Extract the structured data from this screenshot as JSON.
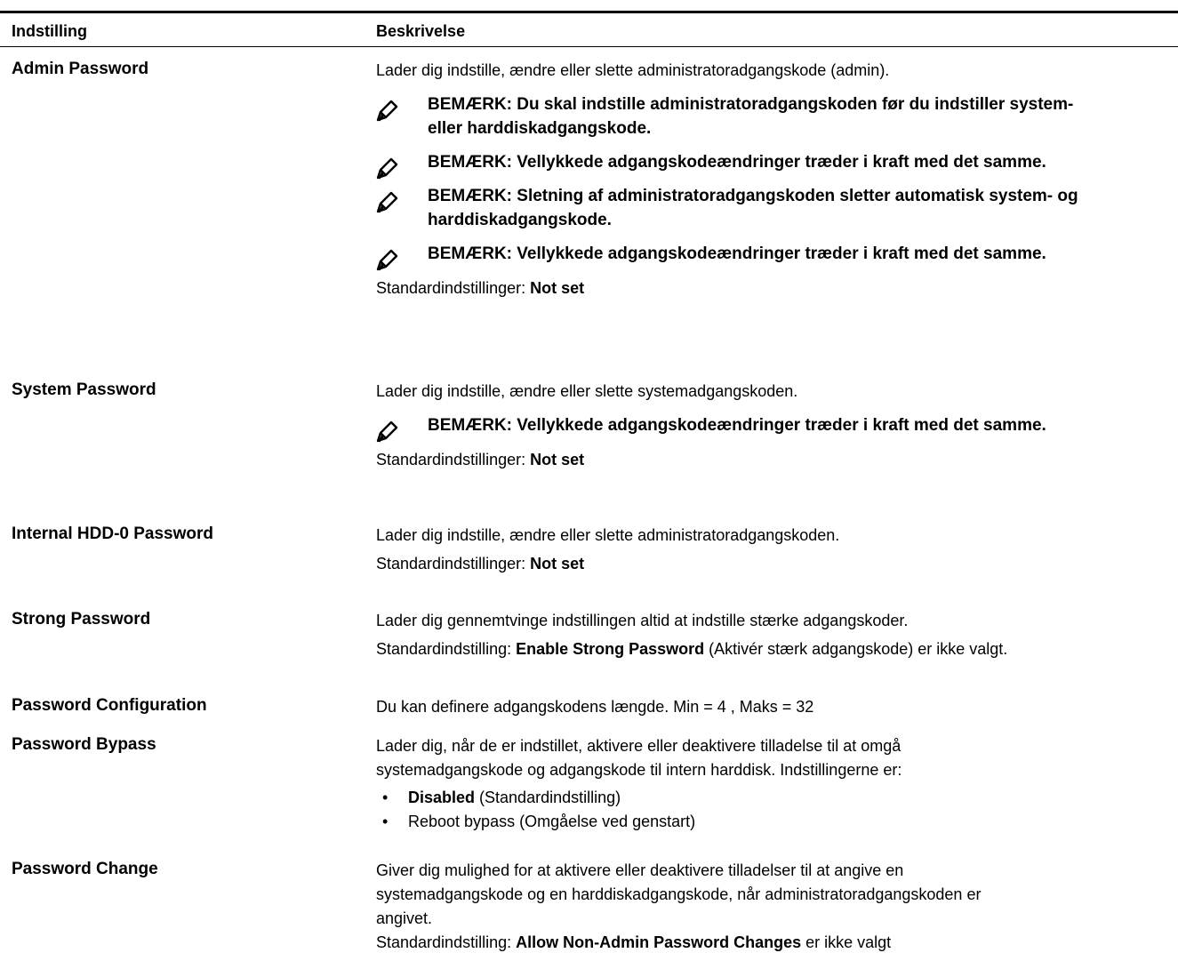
{
  "header": {
    "col1": "Indstilling",
    "col2": "Beskrivelse"
  },
  "rows": {
    "admin": {
      "name": "Admin Password",
      "desc": "Lader dig indstille, ændre eller slette administratoradgangskode (admin).",
      "note1_l1": "BEMÆRK: Du skal indstille administratoradgangskoden før du indstiller system-",
      "note1_l2": "eller harddiskadgangskode.",
      "note2": "BEMÆRK: Vellykkede adgangskodeændringer træder i kraft med det samme.",
      "note3_l1": "BEMÆRK: Sletning af administratoradgangskoden sletter automatisk system- og",
      "note3_l2": "harddiskadgangskode.",
      "note4": "BEMÆRK: Vellykkede adgangskodeændringer træder i kraft med det samme.",
      "default_label": "Standardindstillinger: ",
      "default_value": "Not set"
    },
    "system": {
      "name": "System Password",
      "desc": "Lader dig indstille, ændre eller slette systemadgangskoden.",
      "note1": "BEMÆRK: Vellykkede adgangskodeændringer træder i kraft med det samme.",
      "default_label": "Standardindstillinger: ",
      "default_value": "Not set"
    },
    "hdd": {
      "name": "Internal HDD-0 Password",
      "desc": "Lader dig indstille, ændre eller slette administratoradgangskoden.",
      "default_label": "Standardindstillinger: ",
      "default_value": "Not set"
    },
    "strong": {
      "name": "Strong Password",
      "desc": "Lader dig gennemtvinge indstillingen altid at indstille stærke adgangskoder.",
      "default_label": "Standardindstilling: ",
      "default_value": "Enable Strong Password",
      "default_suffix": " (Aktivér stærk adgangskode) er ikke valgt."
    },
    "config": {
      "name": "Password Configuration",
      "desc": "Du kan definere adgangskodens længde. Min = 4 , Maks = 32"
    },
    "bypass": {
      "name": "Password Bypass",
      "desc_l1": "Lader dig, når de er indstillet, aktivere eller deaktivere tilladelse til at omgå",
      "desc_l2": "systemadgangskode og adgangskode til intern harddisk. Indstillingerne er:",
      "opt1_bold": "Disabled",
      "opt1_rest": " (Standardindstilling)",
      "opt2": "Reboot bypass (Omgåelse ved genstart)",
      "bullet": "•"
    },
    "change": {
      "name": "Password Change",
      "desc_l1": "Giver dig mulighed for at aktivere eller deaktivere tilladelser til at angive en",
      "desc_l2": "systemadgangskode og en harddiskadgangskode, når administratoradgangskoden er",
      "desc_l3": "angivet.",
      "default_label": "Standardindstilling: ",
      "default_value": "Allow Non-Admin Password Changes",
      "default_suffix": " er ikke valgt"
    }
  },
  "icons": {
    "note": "pencil-note-icon"
  }
}
